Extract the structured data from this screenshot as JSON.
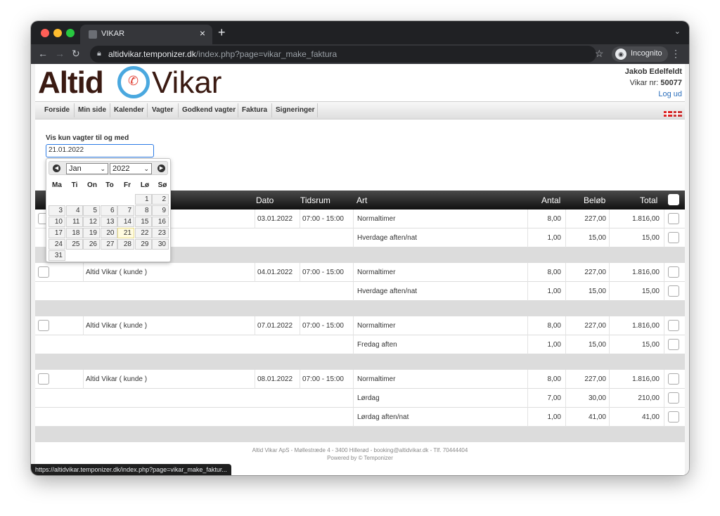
{
  "browser": {
    "tab_title": "VIKAR",
    "url_host": "altidvikar.temponizer.dk",
    "url_path": "/index.php?page=vikar_make_faktura",
    "incognito_label": "Incognito",
    "status_url": "https://altidvikar.temponizer.dk/index.php?page=vikar_make_faktur..."
  },
  "header": {
    "logo_left": "Altid",
    "logo_right": "Vikar",
    "user_name": "Jakob Edelfeldt",
    "vikar_label": "Vikar nr: ",
    "vikar_number": "50077",
    "logout": "Log ud"
  },
  "menu": [
    "Forside",
    "Min side",
    "Kalender",
    "Vagter",
    "Godkend vagter",
    "Faktura",
    "Signeringer"
  ],
  "filter": {
    "label": "Vis kun vagter til og med",
    "value": "21.01.2022"
  },
  "datepicker": {
    "month": "Jan",
    "year": "2022",
    "weekdays": [
      "Ma",
      "Ti",
      "On",
      "To",
      "Fr",
      "Lø",
      "Sø"
    ],
    "days": [
      "1",
      "2",
      "3",
      "4",
      "5",
      "6",
      "7",
      "8",
      "9",
      "10",
      "11",
      "12",
      "13",
      "14",
      "15",
      "16",
      "17",
      "18",
      "19",
      "20",
      "21",
      "22",
      "23",
      "24",
      "25",
      "26",
      "27",
      "28",
      "29",
      "30",
      "31"
    ],
    "today": "21"
  },
  "table": {
    "headers": {
      "dato": "Dato",
      "tidsrum": "Tidsrum",
      "art": "Art",
      "antal": "Antal",
      "belob": "Beløb",
      "total": "Total"
    },
    "groups": [
      {
        "kunde": "",
        "dato": "03.01.2022",
        "tidsrum": "07:00 - 15:00",
        "lines": [
          {
            "art": "Normaltimer",
            "antal": "8,00",
            "belob": "227,00",
            "total": "1.816,00"
          },
          {
            "art": "Hverdage aften/nat",
            "antal": "1,00",
            "belob": "15,00",
            "total": "15,00"
          }
        ]
      },
      {
        "kunde": "Altid Vikar ( kunde )",
        "dato": "04.01.2022",
        "tidsrum": "07:00 - 15:00",
        "lines": [
          {
            "art": "Normaltimer",
            "antal": "8,00",
            "belob": "227,00",
            "total": "1.816,00"
          },
          {
            "art": "Hverdage aften/nat",
            "antal": "1,00",
            "belob": "15,00",
            "total": "15,00"
          }
        ]
      },
      {
        "kunde": "Altid Vikar ( kunde )",
        "dato": "07.01.2022",
        "tidsrum": "07:00 - 15:00",
        "lines": [
          {
            "art": "Normaltimer",
            "antal": "8,00",
            "belob": "227,00",
            "total": "1.816,00"
          },
          {
            "art": "Fredag aften",
            "antal": "1,00",
            "belob": "15,00",
            "total": "15,00"
          }
        ]
      },
      {
        "kunde": "Altid Vikar ( kunde )",
        "dato": "08.01.2022",
        "tidsrum": "07:00 - 15:00",
        "lines": [
          {
            "art": "Normaltimer",
            "antal": "8,00",
            "belob": "227,00",
            "total": "1.816,00"
          },
          {
            "art": "Lørdag",
            "antal": "7,00",
            "belob": "30,00",
            "total": "210,00"
          },
          {
            "art": "Lørdag aften/nat",
            "antal": "1,00",
            "belob": "41,00",
            "total": "41,00"
          }
        ]
      }
    ]
  },
  "footer": {
    "line1": "Altid Vikar ApS - Møllestræde 4 - 3400 Hillerød - booking@altidvikar.dk - Tlf. 70444404",
    "line2": "Powered by © Temponizer"
  },
  "colors": {
    "accent_blue": "#4aa8df",
    "logo_brown": "#3a1a12",
    "phone_red": "#e03a2e"
  }
}
